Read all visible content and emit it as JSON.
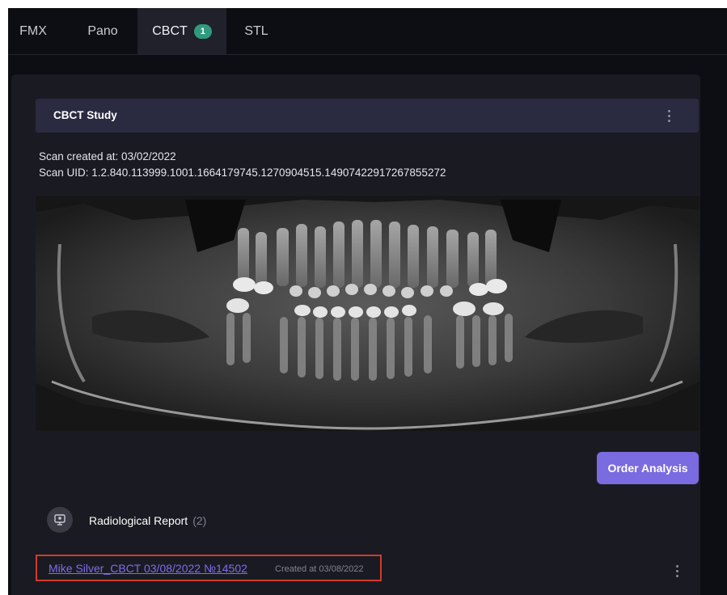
{
  "tabs": [
    {
      "label": "FMX"
    },
    {
      "label": "Pano"
    },
    {
      "label": "CBCT",
      "badge": "1"
    },
    {
      "label": "STL"
    }
  ],
  "study": {
    "title": "CBCT Study",
    "scan_created": "Scan created at: 03/02/2022",
    "scan_uid": "Scan UID: 1.2.840.113999.1001.1664179745.1270904515.14907422917267855272"
  },
  "actions": {
    "order_analysis": "Order Analysis"
  },
  "report_section": {
    "title": "Radiological Report",
    "count": "(2)",
    "items": [
      {
        "name": "Mike Silver_CBCT 03/08/2022 №14502",
        "created": "Created at 03/08/2022"
      }
    ]
  },
  "icons": {
    "study_menu": "kebab-menu-icon",
    "report_section": "report-icon",
    "report_item_menu": "kebab-menu-icon"
  },
  "colors": {
    "background": "#0d0e13",
    "panel": "#1a1b22",
    "header": "#2a2a40",
    "accent": "#7b6be0",
    "badge": "#2f9a7e",
    "highlight_border": "#d23a2c"
  }
}
